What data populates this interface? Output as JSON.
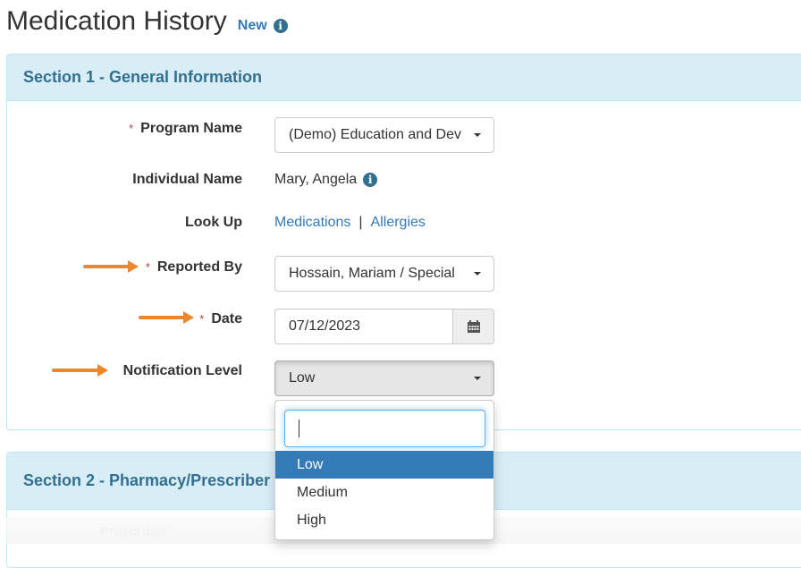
{
  "header": {
    "title": "Medication History",
    "badge": "New",
    "info_icon": "info-circle-icon"
  },
  "section1": {
    "title": "Section 1 - General Information",
    "fields": {
      "program_name": {
        "label": "Program Name",
        "required": true,
        "value": "(Demo) Education and Dev"
      },
      "individual_name": {
        "label": "Individual Name",
        "value": "Mary, Angela"
      },
      "look_up": {
        "label": "Look Up",
        "links": [
          "Medications",
          "Allergies"
        ],
        "separator": "|"
      },
      "reported_by": {
        "label": "Reported By",
        "required": true,
        "value": "Hossain, Mariam / Special"
      },
      "date": {
        "label": "Date",
        "required": true,
        "value": "07/12/2023"
      },
      "notification_level": {
        "label": "Notification Level",
        "value": "Low"
      }
    },
    "required_marker": "*"
  },
  "dropdown": {
    "search_value": "",
    "options": [
      "Low",
      "Medium",
      "High"
    ],
    "selected": "Low"
  },
  "section2": {
    "title": "Section 2 - Pharmacy/Prescriber",
    "faded_label": "Prescriber"
  },
  "colors": {
    "accent": "#337ab7",
    "panel_heading_bg": "#d9edf7",
    "panel_heading_text": "#31708f",
    "annotation_arrow": "#f0862a"
  }
}
